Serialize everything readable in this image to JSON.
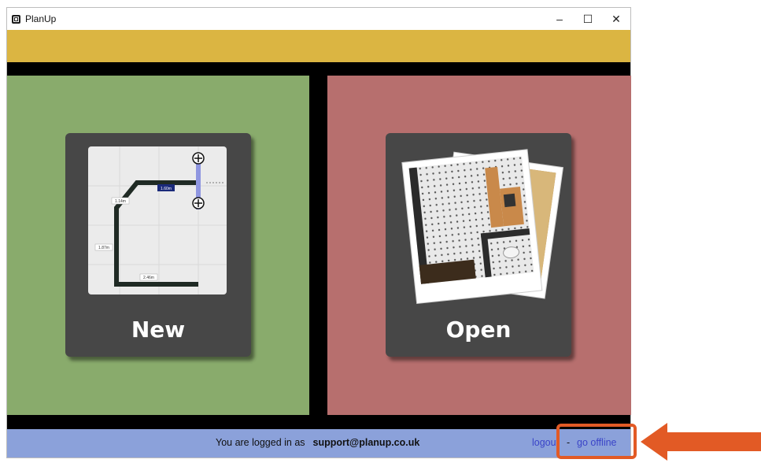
{
  "window": {
    "title": "PlanUp",
    "controls": {
      "minimize": "–",
      "maximize": "☐",
      "close": "✕"
    }
  },
  "panels": {
    "new": {
      "label": "New",
      "color": "#89ab6c"
    },
    "open": {
      "label": "Open",
      "color": "#b76f6e"
    }
  },
  "plan": {
    "dimensions": [
      "1.60m",
      "1.14m",
      "1.87m",
      "2.46m"
    ]
  },
  "status": {
    "prefix": "You are logged in as",
    "user": "support@planup.co.uk",
    "logout": "logout",
    "separator": "-",
    "offline": "go offline"
  },
  "annotation": {
    "color": "#e25a25",
    "target": "go offline"
  }
}
